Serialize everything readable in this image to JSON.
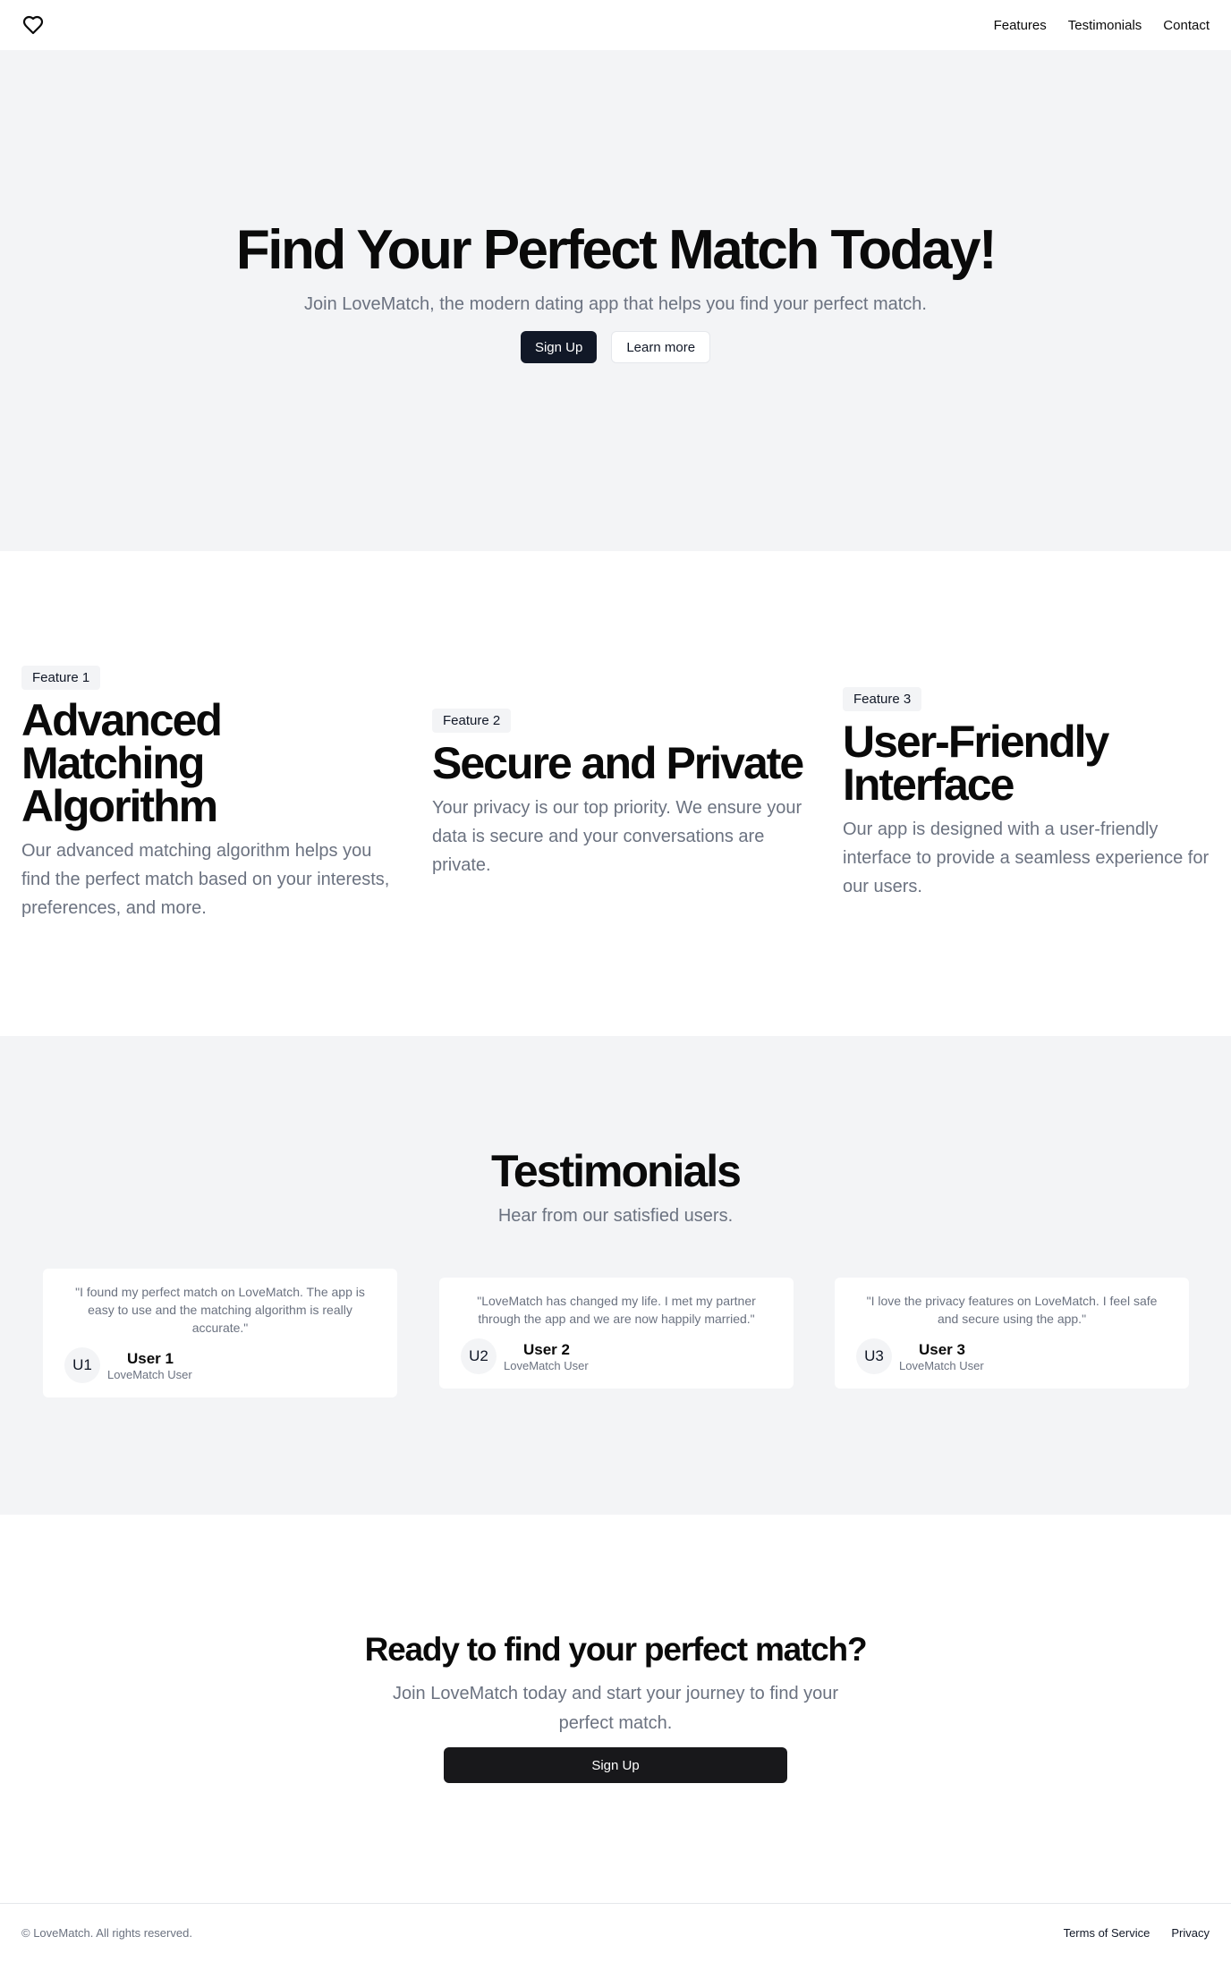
{
  "header": {
    "logo_icon": "heart-icon",
    "nav": [
      "Features",
      "Testimonials",
      "Contact"
    ]
  },
  "hero": {
    "title": "Find Your Perfect Match Today!",
    "subtitle": "Join LoveMatch, the modern dating app that helps you find your perfect match.",
    "primary_button": "Sign Up",
    "secondary_button": "Learn more"
  },
  "features": [
    {
      "badge": "Feature 1",
      "title": "Advanced Matching Algorithm",
      "description": "Our advanced matching algorithm helps you find the perfect match based on your interests, preferences, and more."
    },
    {
      "badge": "Feature 2",
      "title": "Secure and Private",
      "description": "Your privacy is our top priority. We ensure your data is secure and your conversations are private."
    },
    {
      "badge": "Feature 3",
      "title": "User-Friendly Interface",
      "description": "Our app is designed with a user-friendly interface to provide a seamless experience for our users."
    }
  ],
  "testimonials": {
    "title": "Testimonials",
    "subtitle": "Hear from our satisfied users.",
    "items": [
      {
        "quote": "\"I found my perfect match on LoveMatch. The app is easy to use and the matching algorithm is really accurate.\"",
        "initials": "U1",
        "name": "User 1",
        "role": "LoveMatch User"
      },
      {
        "quote": "\"LoveMatch has changed my life. I met my partner through the app and we are now happily married.\"",
        "initials": "U2",
        "name": "User 2",
        "role": "LoveMatch User"
      },
      {
        "quote": "\"I love the privacy features on LoveMatch. I feel safe and secure using the app.\"",
        "initials": "U3",
        "name": "User 3",
        "role": "LoveMatch User"
      }
    ]
  },
  "cta": {
    "title": "Ready to find your perfect match?",
    "subtitle": "Join LoveMatch today and start your journey to find your perfect match.",
    "button": "Sign Up"
  },
  "footer": {
    "copyright": "© LoveMatch. All rights reserved.",
    "links": [
      "Terms of Service",
      "Privacy"
    ]
  }
}
